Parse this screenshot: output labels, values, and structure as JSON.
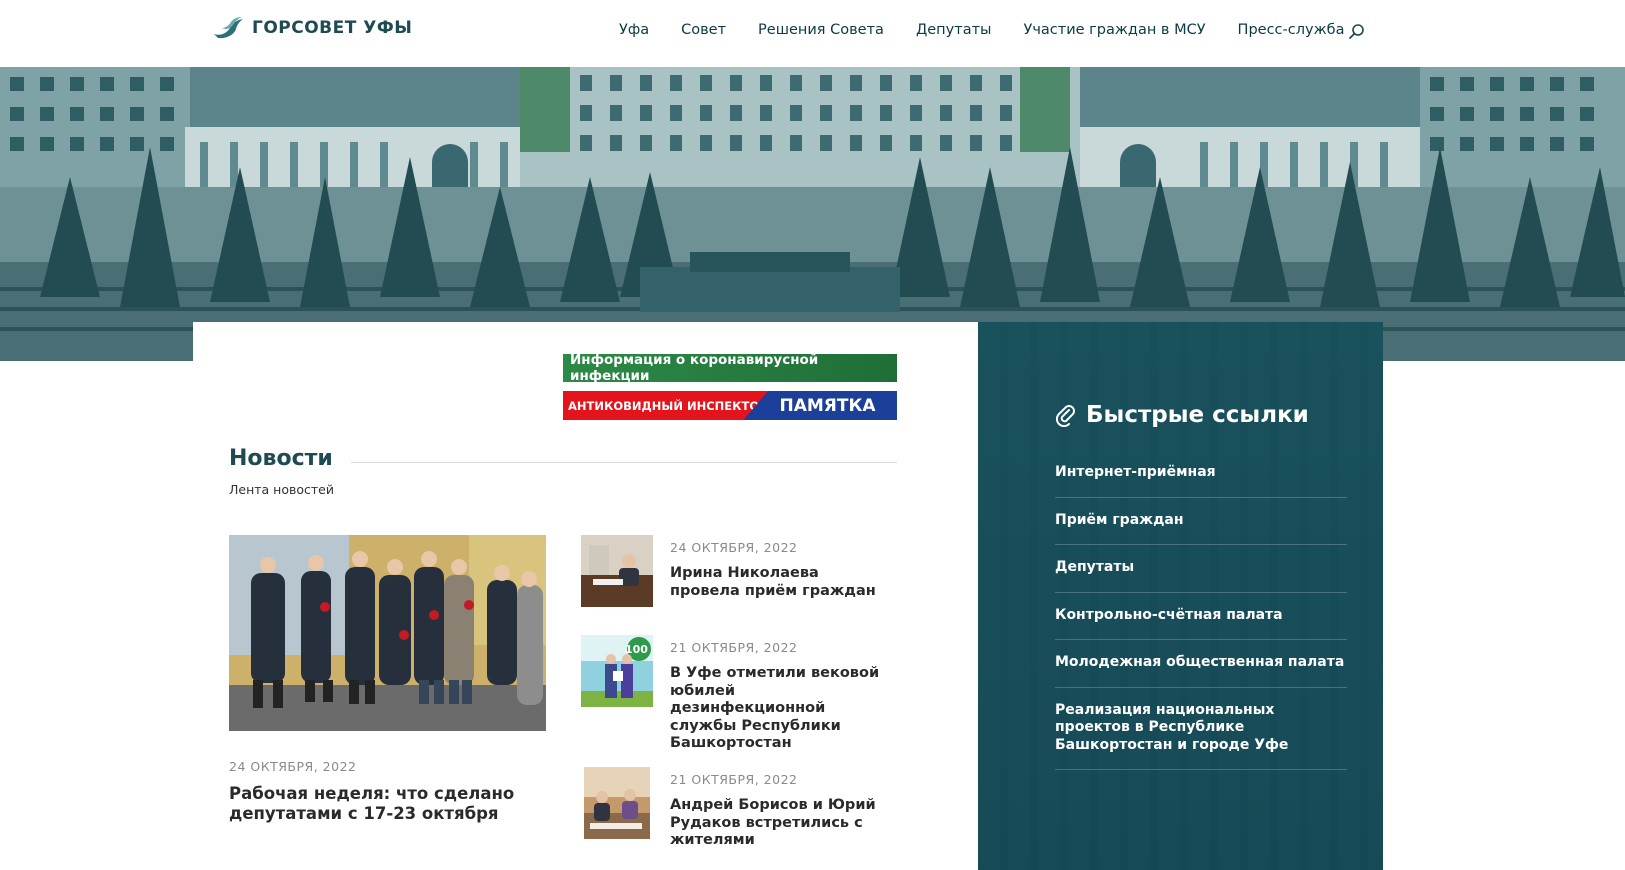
{
  "header": {
    "logo_text": "ГОРСОВЕТ УФЫ",
    "nav": [
      {
        "label": "Уфа"
      },
      {
        "label": "Совет"
      },
      {
        "label": "Решения Совета"
      },
      {
        "label": "Депутаты"
      },
      {
        "label": "Участие граждан в МСУ"
      },
      {
        "label": "Пресс-служба"
      }
    ]
  },
  "banners": {
    "covid_info": "Информация о коронавирусной инфекции",
    "inspector": "АНТИКОВИДНЫЙ ИНСПЕКТОР",
    "memo": "ПАМЯТКА"
  },
  "news": {
    "title": "Новости",
    "subtitle": "Лента новостей",
    "feature": {
      "date": "24 ОКТЯБРЯ, 2022",
      "title": "Рабочая неделя: что сделано депутатами с 17-23 октября"
    },
    "items": [
      {
        "date": "24 ОКТЯБРЯ, 2022",
        "title": "Ирина Николаева провела приём граждан"
      },
      {
        "date": "21 ОКТЯБРЯ, 2022",
        "title": "В Уфе отметили вековой юбилей дезинфекционной службы Республики Башкортостан"
      },
      {
        "date": "21 ОКТЯБРЯ, 2022",
        "title": "Андрей Борисов и Юрий Рудаков встретились с жителями"
      }
    ]
  },
  "sidebar": {
    "title": "Быстрые ссылки",
    "links": [
      {
        "label": "Интернет-приёмная"
      },
      {
        "label": "Приём граждан"
      },
      {
        "label": "Депутаты"
      },
      {
        "label": "Контрольно-счётная палата"
      },
      {
        "label": "Молодежная общественная палата"
      },
      {
        "label": "Реализация национальных проектов в Республике Башкортостан и городе Уфе"
      }
    ]
  },
  "colors": {
    "brand_dark": "#1e4a52",
    "sidebar_bg": "#164e5a",
    "covid_green": "#2d8a46",
    "inspector_red": "#e3141b",
    "memo_blue": "#1c3f9a"
  }
}
